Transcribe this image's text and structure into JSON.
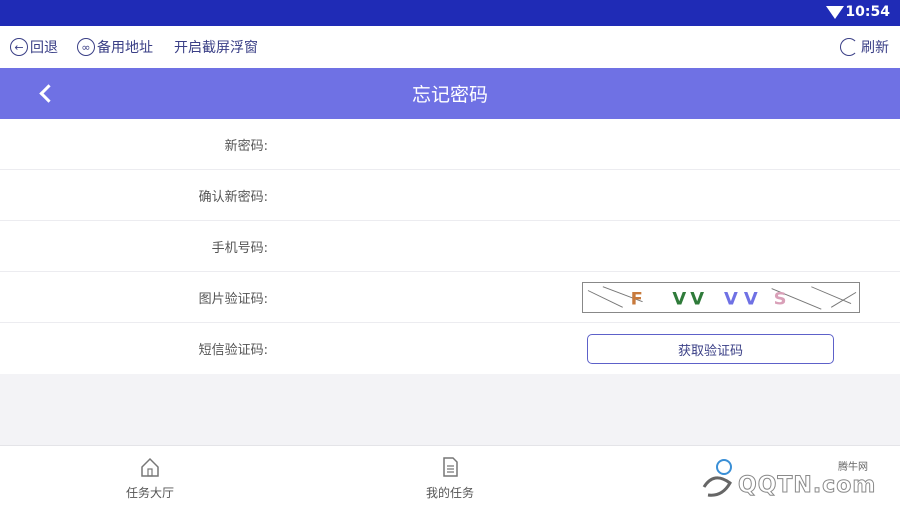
{
  "status_bar": {
    "time": "10:54"
  },
  "toolbar": {
    "back_label": "回退",
    "backup_label": "备用地址",
    "float_label": "开启截屏浮窗",
    "refresh_label": "刷新"
  },
  "header": {
    "title": "忘记密码"
  },
  "form": {
    "new_password_label": "新密码:",
    "confirm_password_label": "确认新密码:",
    "phone_label": "手机号码:",
    "image_code_label": "图片验证码:",
    "sms_code_label": "短信验证码:",
    "captcha_text": "FVVVS",
    "get_code_button": "获取验证码"
  },
  "bottom_nav": {
    "items": [
      {
        "label": "任务大厅",
        "icon": "home-icon"
      },
      {
        "label": "我的任务",
        "icon": "document-icon"
      }
    ]
  },
  "watermark": {
    "brand": "QQTN.com",
    "small": "腾牛网"
  },
  "colors": {
    "statusbar": "#1f2bb6",
    "header": "#6f71e4",
    "accent": "#3a3f86"
  }
}
